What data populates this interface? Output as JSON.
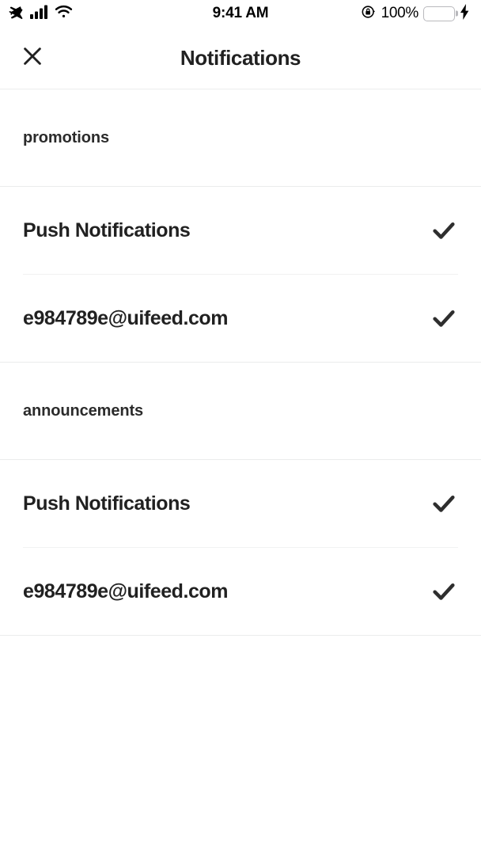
{
  "status_bar": {
    "airplane_icon": "airplane-icon",
    "signal_icon": "cellular-signal-icon",
    "signal_bars": 4,
    "wifi_icon": "wifi-icon",
    "time": "9:41 AM",
    "rotation_lock_icon": "rotation-lock-icon",
    "battery_percent": "100%",
    "battery_level": 100,
    "battery_color": "#4CD964",
    "charging_icon": "lightning-bolt-icon"
  },
  "nav": {
    "close_icon": "close-icon",
    "title": "Notifications"
  },
  "sections": [
    {
      "header": "promotions",
      "rows": [
        {
          "label": "Push Notifications",
          "checked": true,
          "check_icon": "checkmark-icon"
        },
        {
          "label": "e984789e@uifeed.com",
          "checked": true,
          "check_icon": "checkmark-icon"
        }
      ]
    },
    {
      "header": "announcements",
      "rows": [
        {
          "label": "Push Notifications",
          "checked": true,
          "check_icon": "checkmark-icon"
        },
        {
          "label": "e984789e@uifeed.com",
          "checked": true,
          "check_icon": "checkmark-icon"
        }
      ]
    }
  ],
  "colors": {
    "text_primary": "#212121",
    "divider": "#ebecec",
    "inset_divider": "#f1f2f2",
    "check": "#2e2e2e",
    "background": "#ffffff"
  }
}
